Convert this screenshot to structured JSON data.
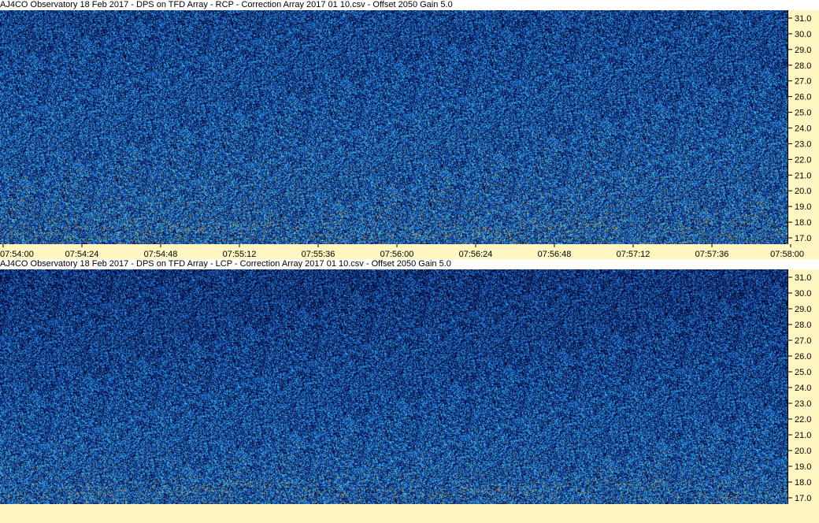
{
  "panels": [
    {
      "title": "AJ4CO Observatory 18 Feb 2017  -  DPS on TFD Array  -  RCP  -  Correction Array 2017 01 10.csv  -  Offset 2050  Gain 5.0",
      "polarization": "RCP"
    },
    {
      "title": "AJ4CO Observatory 18 Feb 2017  -  DPS on TFD Array  -  LCP  -  Correction Array 2017 01 10.csv  -  Offset 2050  Gain 5.0",
      "polarization": "LCP"
    }
  ],
  "colors": {
    "axis_background": "#fff6c2",
    "spectrum_dark": "#0a1a5c",
    "spectrum_mid": "#1f6fd6",
    "spectrum_light": "#38c8f0",
    "spectrum_hot": "#e8a020"
  },
  "chart_data": {
    "type": "heatmap",
    "x": {
      "ticks": [
        "07:54:00",
        "07:54:24",
        "07:54:48",
        "07:55:12",
        "07:55:36",
        "07:56:00",
        "07:56:24",
        "07:56:48",
        "07:57:12",
        "07:57:36",
        "07:58:00"
      ],
      "range": [
        "07:54:00",
        "07:58:00"
      ]
    },
    "y": {
      "ticks": [
        "31.0",
        "30.0",
        "29.0",
        "28.0",
        "27.0",
        "26.0",
        "25.0",
        "24.0",
        "23.0",
        "22.0",
        "21.0",
        "20.0",
        "19.0",
        "18.0",
        "17.0"
      ],
      "range": [
        16.6,
        31.5
      ]
    },
    "series": [
      {
        "name": "RCP"
      },
      {
        "name": "LCP"
      }
    ]
  }
}
